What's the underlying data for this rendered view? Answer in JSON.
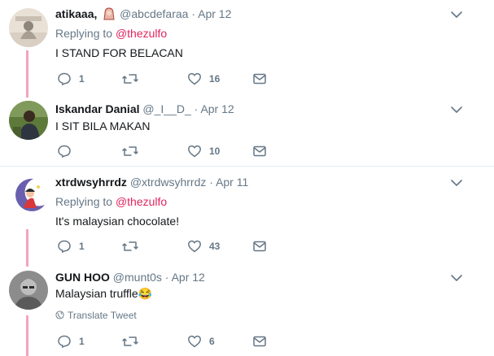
{
  "tweets": [
    {
      "name": "atikaaa,",
      "handle": "@abcdefaraa",
      "date": "Apr 12",
      "replying_prefix": "Replying to",
      "replying_handle": "@thezulfo",
      "text": "I STAND FOR BELACAN",
      "replies": "1",
      "retweets": "",
      "likes": "16"
    },
    {
      "name": "Iskandar Danial",
      "handle": "@_I__D_",
      "date": "Apr 12",
      "text": "I SIT BILA MAKAN",
      "replies": "",
      "retweets": "",
      "likes": "10"
    },
    {
      "name": "xtrdwsyhrrdz",
      "handle": "@xtrdwsyhrrdz",
      "date": "Apr 11",
      "replying_prefix": "Replying to",
      "replying_handle": "@thezulfo",
      "text": "It's malaysian chocolate!",
      "replies": "1",
      "retweets": "",
      "likes": "43"
    },
    {
      "name": "GUN HOO",
      "handle": "@munt0s",
      "date": "Apr 12",
      "text": "Malaysian truffle😂",
      "translate_label": "Translate Tweet",
      "replies": "1",
      "retweets": "",
      "likes": "6"
    }
  ],
  "colors": {
    "thread_line": "#f5a3bd",
    "mention": "#e0245e",
    "secondary_text": "#657786",
    "divider": "#e6ecf0"
  },
  "icons": [
    "reply-icon",
    "retweet-icon",
    "like-icon",
    "message-icon",
    "chevron-down-icon",
    "globe-icon"
  ]
}
